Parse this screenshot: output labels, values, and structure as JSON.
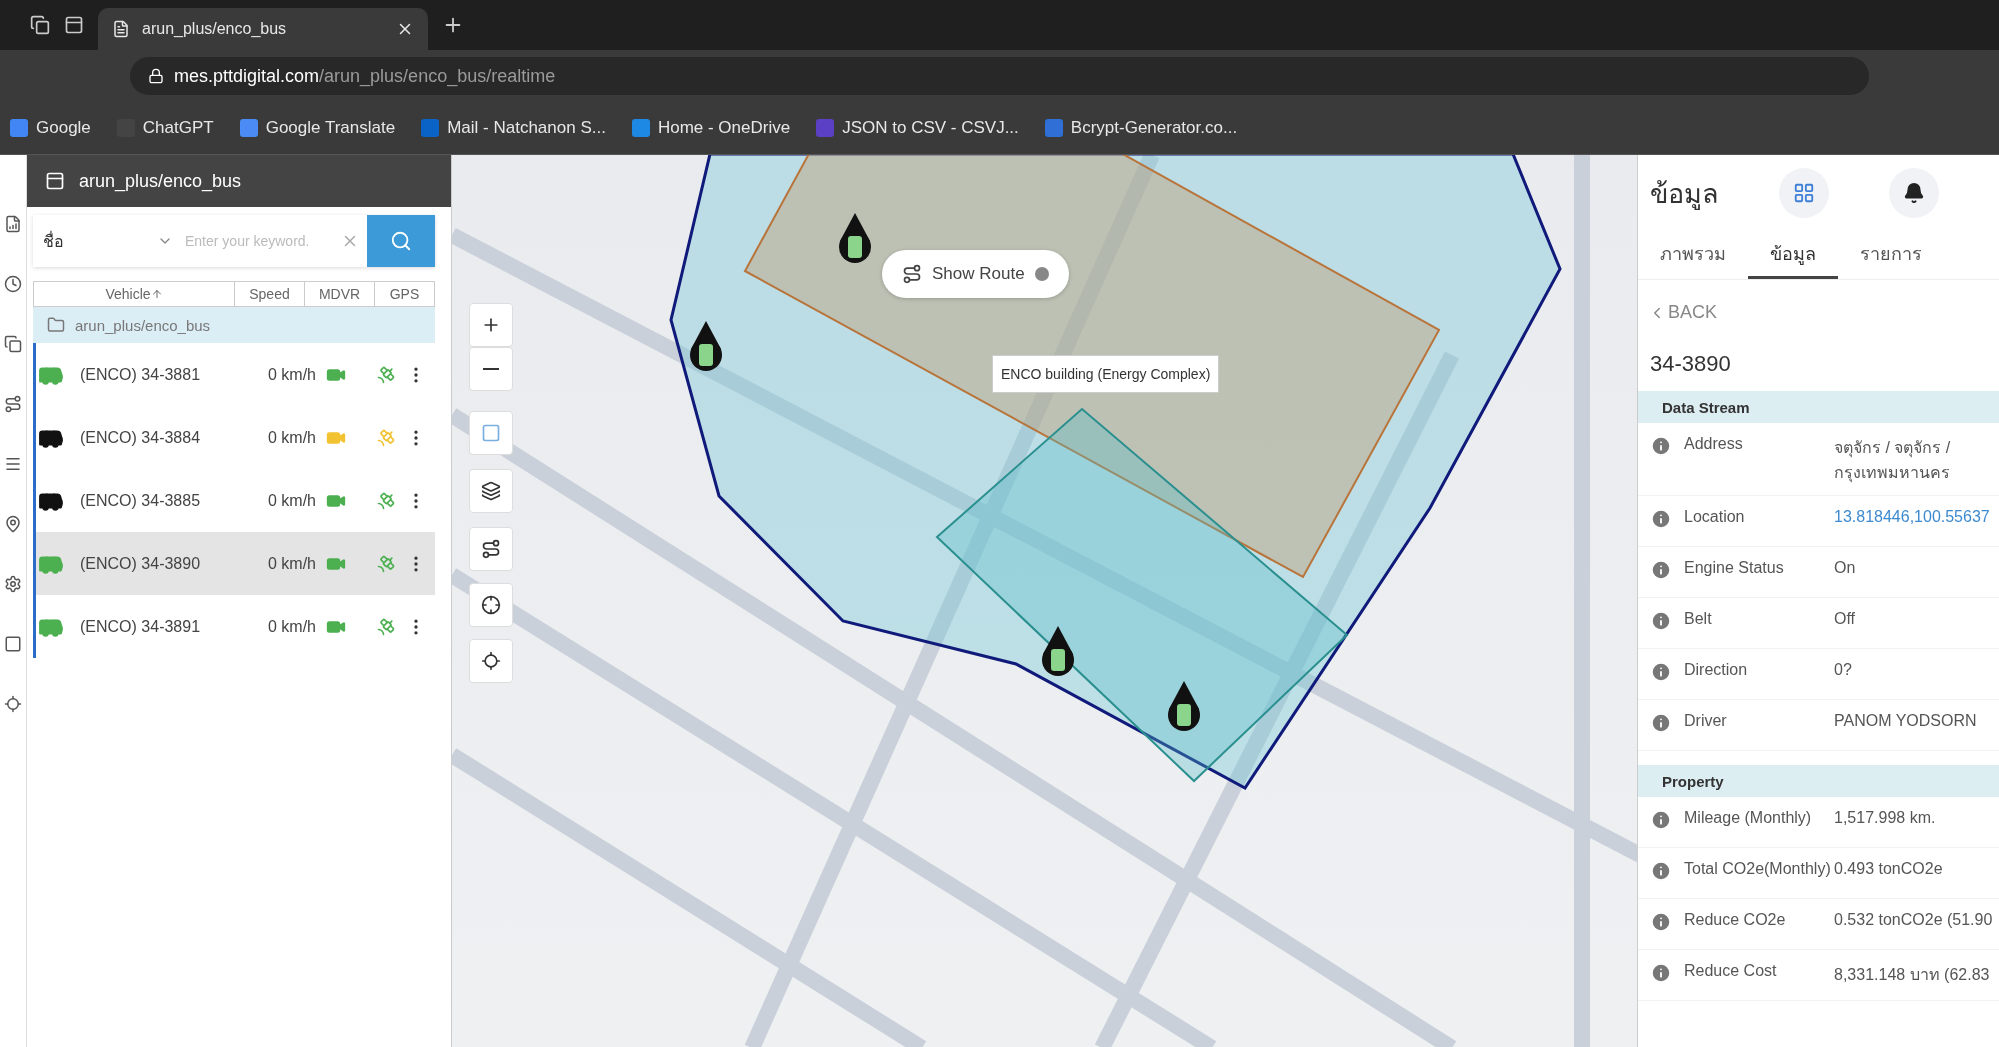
{
  "browser": {
    "tab_title": "arun_plus/enco_bus",
    "url": {
      "host": "mes.pttdigital.com",
      "path": "/arun_plus/enco_bus/realtime"
    },
    "bookmarks": [
      {
        "label": "Google"
      },
      {
        "label": "ChatGPT"
      },
      {
        "label": "Google Translate"
      },
      {
        "label": "Mail - Natchanon S..."
      },
      {
        "label": "Home - OneDrive"
      },
      {
        "label": "JSON to CSV - CSVJ..."
      },
      {
        "label": "Bcrypt-Generator.co..."
      }
    ]
  },
  "left_panel": {
    "title": "arun_plus/enco_bus",
    "search": {
      "field": "ชื่อ",
      "placeholder": "Enter your keyword."
    },
    "columns": [
      "Vehicle",
      "Speed",
      "MDVR",
      "GPS"
    ],
    "group": "arun_plus/enco_bus",
    "vehicles": [
      {
        "name": "(ENCO) 34-3881",
        "speed": "0 km/h",
        "engine_on": true,
        "mdvr_warning": false,
        "gps_warning": false,
        "selected": false
      },
      {
        "name": "(ENCO) 34-3884",
        "speed": "0 km/h",
        "engine_on": false,
        "mdvr_warning": true,
        "gps_warning": true,
        "selected": false
      },
      {
        "name": "(ENCO) 34-3885",
        "speed": "0 km/h",
        "engine_on": false,
        "mdvr_warning": false,
        "gps_warning": false,
        "selected": false
      },
      {
        "name": "(ENCO) 34-3890",
        "speed": "0 km/h",
        "engine_on": true,
        "mdvr_warning": false,
        "gps_warning": false,
        "selected": true
      },
      {
        "name": "(ENCO) 34-3891",
        "speed": "0 km/h",
        "engine_on": true,
        "mdvr_warning": false,
        "gps_warning": false,
        "selected": false
      }
    ]
  },
  "map": {
    "show_route": "Show Route",
    "tooltip": "ENCO building (Energy Complex)"
  },
  "right_panel": {
    "title": "ข้อมูล",
    "tabs": [
      {
        "label": "ภาพรวม",
        "selected": false
      },
      {
        "label": "ข้อมูล",
        "selected": true
      },
      {
        "label": "รายการ",
        "selected": false
      }
    ],
    "back": "BACK",
    "vehicle_id": "34-3890",
    "sections": [
      {
        "title": "Data Stream",
        "rows": [
          {
            "label": "Address",
            "value": "จตุจักร / จตุจักร / กรุงเทพมหานคร",
            "kind": "text"
          },
          {
            "label": "Location",
            "value": "13.818446,100.55637",
            "kind": "link"
          },
          {
            "label": "Engine Status",
            "value": "On",
            "kind": "text"
          },
          {
            "label": "Belt",
            "value": "Off",
            "kind": "text"
          },
          {
            "label": "Direction",
            "value": "0?",
            "kind": "text"
          },
          {
            "label": "Driver",
            "value": "PANOM YODSORN",
            "kind": "text"
          }
        ]
      },
      {
        "title": "Property",
        "rows": [
          {
            "label": "Mileage (Monthly)",
            "value": "1,517.998 km.",
            "kind": "text"
          },
          {
            "label": "Total CO2e(Monthly)",
            "value": "0.493 tonCO2e",
            "kind": "text"
          },
          {
            "label": "Reduce CO2e",
            "value": "0.532 tonCO2e (51.90",
            "kind": "text"
          },
          {
            "label": "Reduce Cost",
            "value": "8,331.148 บาท (62.83",
            "kind": "text"
          }
        ]
      }
    ]
  }
}
